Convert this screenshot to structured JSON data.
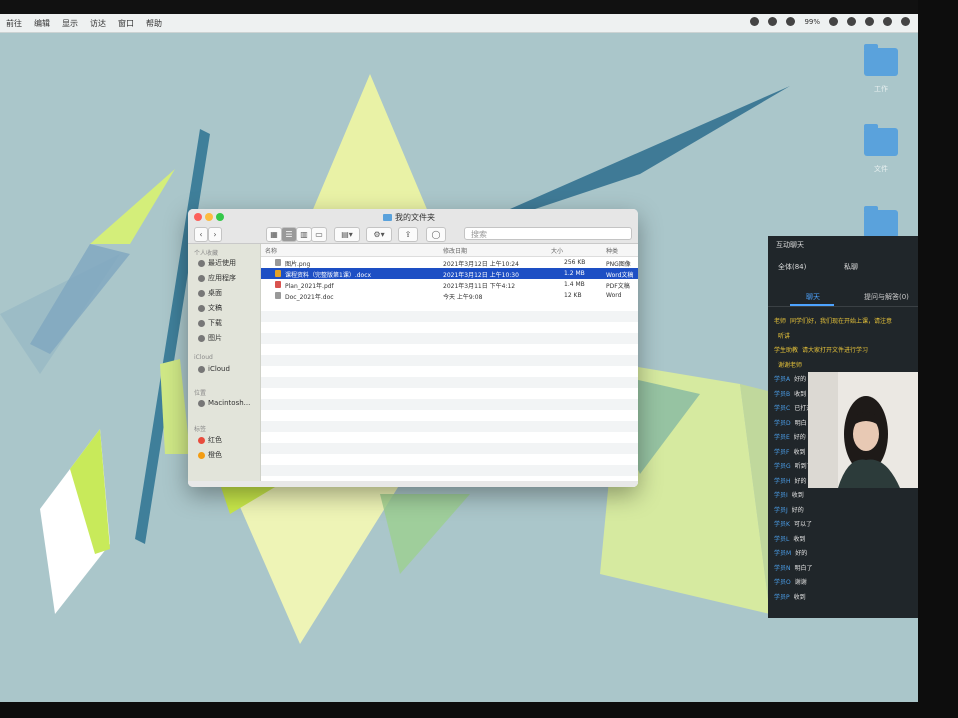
{
  "menubar": {
    "items": [
      "前往",
      "编辑",
      "显示",
      "访达",
      "窗口",
      "帮助"
    ],
    "right": [
      "99%"
    ]
  },
  "desktop": {
    "folders": [
      {
        "label": "工作"
      },
      {
        "label": "文件"
      },
      {
        "label": ""
      }
    ]
  },
  "finder": {
    "title": "我的文件夹",
    "search_placeholder": "搜索",
    "sidebar": {
      "section_favorites": "个人收藏",
      "favorites": [
        "最近使用",
        "应用程序",
        "桌面",
        "文稿",
        "下载",
        "图片"
      ],
      "section_icloud": "iCloud",
      "icloud": [
        "iCloud"
      ],
      "section_locations": "位置",
      "locations": [
        "Macintosh..."
      ],
      "section_tags": "标签",
      "tags": [
        "红色",
        "橙色"
      ]
    },
    "columns": [
      "名称",
      "修改日期",
      "大小",
      "种类"
    ],
    "files": [
      {
        "name": "图片.png",
        "date": "2021年3月12日 上午10:24",
        "size": "256 KB",
        "kind": "PNG图像",
        "selected": false
      },
      {
        "name": "课程资料（完整版第1课）.docx",
        "date": "2021年3月12日 上午10:30",
        "size": "1.2 MB",
        "kind": "Word文稿",
        "selected": true
      },
      {
        "name": "Plan_2021年.pdf",
        "date": "2021年3月11日 下午4:12",
        "size": "1.4 MB",
        "kind": "PDF文稿",
        "selected": false
      },
      {
        "name": "Doc_2021年.doc",
        "date": "今天 上午9:08",
        "size": "12 KB",
        "kind": "Word",
        "selected": false
      }
    ]
  },
  "chat": {
    "header": "互动聊天",
    "sub_left": "全体(84)",
    "sub_right": "私聊",
    "tab_left": "聊天",
    "tab_right": "提问与解答(0)",
    "messages": [
      {
        "name": "老师",
        "text": "同学们好，我们现在开始上课，请注意",
        "highlight": true
      },
      {
        "name": "",
        "text": "听讲",
        "highlight": true
      },
      {
        "name": "学生助教",
        "text": "请大家打开文件进行学习",
        "highlight": true
      },
      {
        "name": "",
        "text": "谢谢老师",
        "highlight": true
      },
      {
        "name": "学员A",
        "text": "好的",
        "highlight": false
      },
      {
        "name": "学员B",
        "text": "收到",
        "highlight": false
      },
      {
        "name": "学员C",
        "text": "已打开",
        "highlight": false
      },
      {
        "name": "学员D",
        "text": "明白",
        "highlight": false
      },
      {
        "name": "学员E",
        "text": "好的",
        "highlight": false
      },
      {
        "name": "学员F",
        "text": "收到",
        "highlight": false
      },
      {
        "name": "学员G",
        "text": "听到了",
        "highlight": false
      },
      {
        "name": "学员H",
        "text": "好的",
        "highlight": false
      },
      {
        "name": "学员I",
        "text": "收到",
        "highlight": false
      },
      {
        "name": "学员J",
        "text": "好的",
        "highlight": false
      },
      {
        "name": "学员K",
        "text": "可以了",
        "highlight": false
      },
      {
        "name": "学员L",
        "text": "收到",
        "highlight": false
      },
      {
        "name": "学员M",
        "text": "好的",
        "highlight": false
      },
      {
        "name": "学员N",
        "text": "明白了",
        "highlight": false
      },
      {
        "name": "学员O",
        "text": "谢谢",
        "highlight": false
      },
      {
        "name": "学员P",
        "text": "收到",
        "highlight": false
      }
    ]
  }
}
